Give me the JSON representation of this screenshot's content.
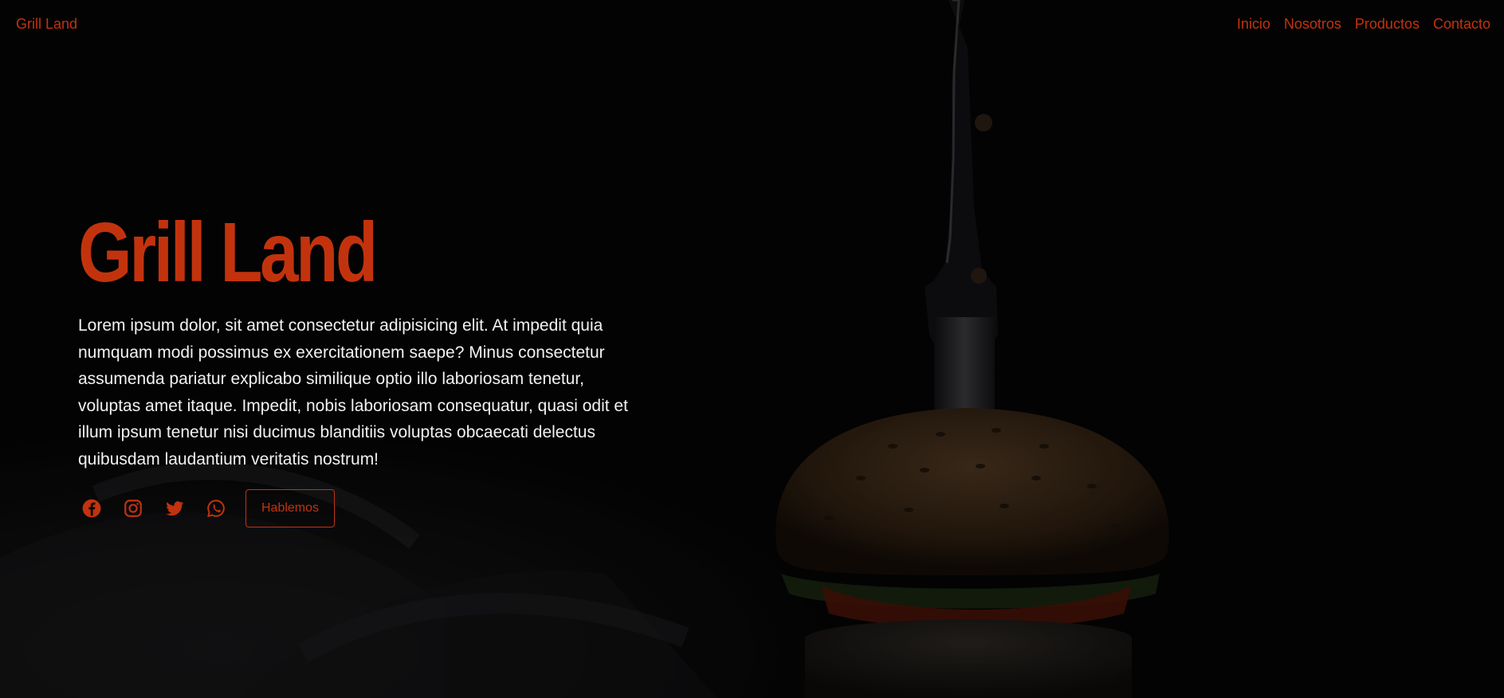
{
  "nav": {
    "brand": "Grill Land",
    "links": [
      {
        "label": "Inicio"
      },
      {
        "label": "Nosotros"
      },
      {
        "label": "Productos"
      },
      {
        "label": "Contacto"
      }
    ]
  },
  "hero": {
    "title": "Grill Land",
    "text": "Lorem ipsum dolor, sit amet consectetur adipisicing elit. At impedit quia numquam modi possimus ex exercitationem saepe? Minus consectetur assumenda pariatur explicabo similique optio illo laboriosam tenetur, voluptas amet itaque. Impedit, nobis laboriosam consequatur, quasi odit et illum ipsum tenetur nisi ducimus blanditiis voluptas obcaecati delectus quibusdam laudantium veritatis nostrum!",
    "social_icons": [
      "facebook-icon",
      "instagram-icon",
      "twitter-icon",
      "whatsapp-icon"
    ],
    "cta_label": "Hablemos"
  },
  "colors": {
    "accent": "#c2330d",
    "background": "#050505",
    "text": "#f2f2f2"
  }
}
